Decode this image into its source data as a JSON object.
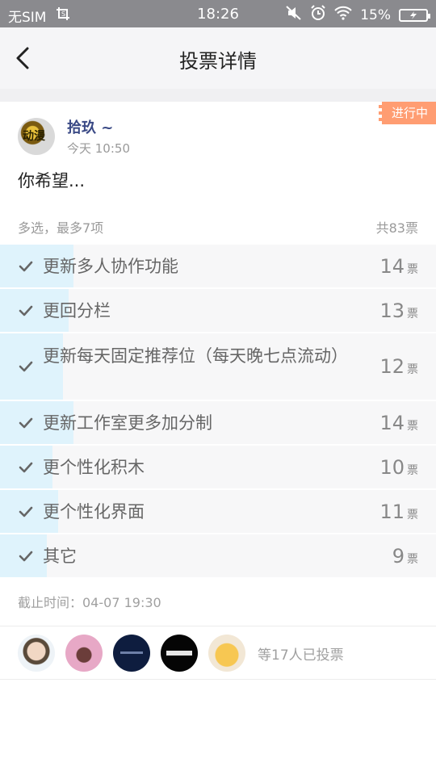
{
  "status_bar": {
    "carrier": "无SIM",
    "time": "18:26",
    "battery": "15%",
    "icons": [
      "screenshot-icon",
      "mute-icon",
      "alarm-icon",
      "wifi-icon",
      "battery-icon"
    ]
  },
  "nav": {
    "title": "投票详情",
    "back_icon": "chevron-left-icon"
  },
  "post": {
    "badge": "进行中",
    "author": "拾玖 ~",
    "time": "今天 10:50",
    "question": "你希望...",
    "rule": "多选，最多7项",
    "total": "共83票"
  },
  "options": [
    {
      "label": "更新多人协作功能",
      "votes": "14",
      "unit": "票",
      "fraction": 0.169
    },
    {
      "label": "更回分栏",
      "votes": "13",
      "unit": "票",
      "fraction": 0.157
    },
    {
      "label": "更新每天固定推荐位（每天晚七点流动）",
      "votes": "12",
      "unit": "票",
      "fraction": 0.145
    },
    {
      "label": "更新工作室更多加分制",
      "votes": "14",
      "unit": "票",
      "fraction": 0.169
    },
    {
      "label": "更个性化积木",
      "votes": "10",
      "unit": "票",
      "fraction": 0.12
    },
    {
      "label": "更个性化界面",
      "votes": "11",
      "unit": "票",
      "fraction": 0.133
    },
    {
      "label": "其它",
      "votes": "9",
      "unit": "票",
      "fraction": 0.108
    }
  ],
  "deadline": "截止时间：04-07 19:30",
  "voters": {
    "summary": "等17人已投票"
  },
  "colors": {
    "badge": "#ff9d72",
    "author": "#3b4a86",
    "bar_fill": "#dff3fc",
    "option_bg": "#f7f7f8"
  }
}
